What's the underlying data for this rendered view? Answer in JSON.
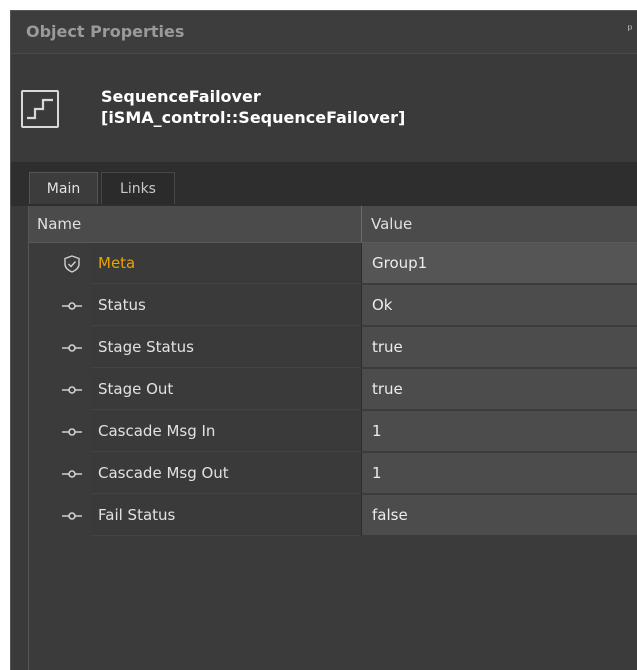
{
  "window": {
    "title": "Object Properties",
    "pin_glyph": "ᵖ"
  },
  "object": {
    "name": "SequenceFailover",
    "type": "[iSMA_control::SequenceFailover]",
    "icon": "sequence-step-icon"
  },
  "tabs": [
    {
      "label": "Main",
      "active": true
    },
    {
      "label": "Links",
      "active": false
    }
  ],
  "grid": {
    "headers": {
      "name": "Name",
      "value": "Value"
    },
    "rows": [
      {
        "name": "Meta",
        "value": "Group1",
        "icon": "shield-icon",
        "highlight_color": "#e8a300"
      },
      {
        "name": "Status",
        "value": "Ok",
        "icon": "slot-pin-icon"
      },
      {
        "name": "Stage Status",
        "value": "true",
        "icon": "slot-pin-icon"
      },
      {
        "name": "Stage Out",
        "value": "true",
        "icon": "slot-pin-icon"
      },
      {
        "name": "Cascade Msg In",
        "value": "1",
        "icon": "slot-pin-icon"
      },
      {
        "name": "Cascade Msg Out",
        "value": "1",
        "icon": "slot-pin-icon"
      },
      {
        "name": "Fail Status",
        "value": "false",
        "icon": "slot-pin-icon"
      }
    ]
  }
}
